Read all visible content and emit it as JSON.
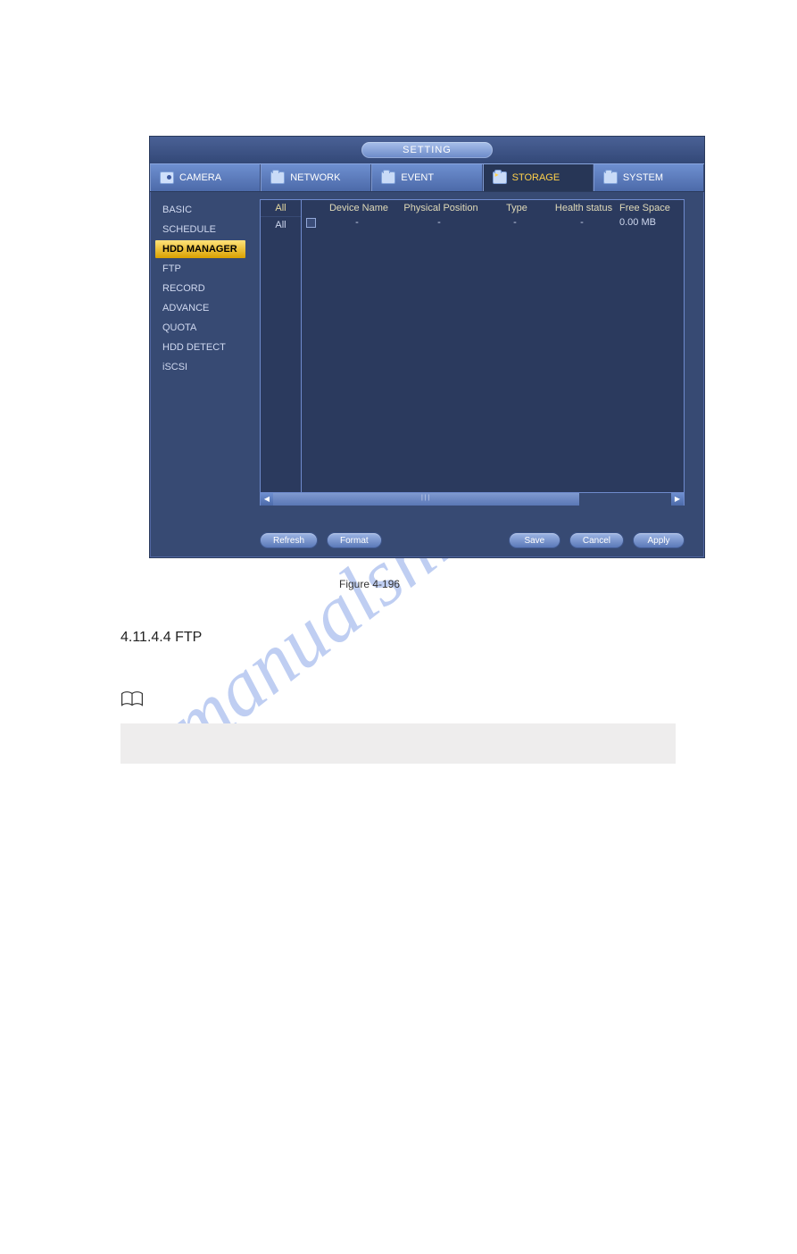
{
  "window": {
    "title": "SETTING"
  },
  "tabs": [
    {
      "id": "camera",
      "label": "CAMERA",
      "active": false
    },
    {
      "id": "network",
      "label": "NETWORK",
      "active": false
    },
    {
      "id": "event",
      "label": "EVENT",
      "active": false
    },
    {
      "id": "storage",
      "label": "STORAGE",
      "active": true
    },
    {
      "id": "system",
      "label": "SYSTEM",
      "active": false
    }
  ],
  "sidebar": {
    "items": [
      {
        "label": "BASIC",
        "selected": false
      },
      {
        "label": "SCHEDULE",
        "selected": false
      },
      {
        "label": "HDD MANAGER",
        "selected": true
      },
      {
        "label": "FTP",
        "selected": false
      },
      {
        "label": "RECORD",
        "selected": false
      },
      {
        "label": "ADVANCE",
        "selected": false
      },
      {
        "label": "QUOTA",
        "selected": false
      },
      {
        "label": "HDD DETECT",
        "selected": false
      },
      {
        "label": "iSCSI",
        "selected": false
      }
    ]
  },
  "table": {
    "left_header": "All",
    "left_rows": [
      "All"
    ],
    "headers": {
      "device_name": "Device Name",
      "physical_position": "Physical Position",
      "type": "Type",
      "health_status": "Health status",
      "free_space": "Free Space"
    },
    "rows": [
      {
        "checked": false,
        "device_name": "-",
        "physical_position": "-",
        "type": "-",
        "health_status": "-",
        "free_space": "0.00 MB"
      }
    ]
  },
  "buttons": {
    "refresh": "Refresh",
    "format": "Format",
    "save": "Save",
    "cancel": "Cancel",
    "apply": "Apply"
  },
  "caption": "Figure 4-196",
  "section_title": "4.11.4.4 FTP",
  "watermark": "manualshive.com"
}
